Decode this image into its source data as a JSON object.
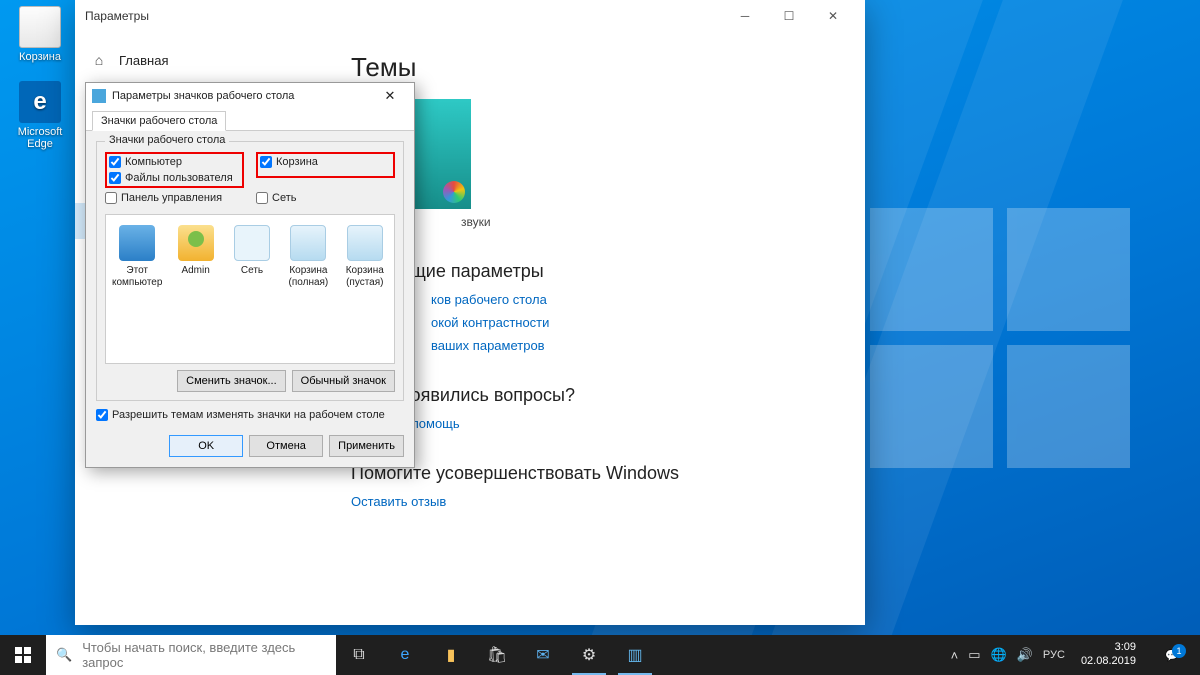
{
  "desktop": {
    "icons": [
      {
        "label": "Корзина"
      },
      {
        "label": "Microsoft Edge"
      }
    ]
  },
  "settings": {
    "title": "Параметры",
    "sidebar": {
      "home": "Главная"
    },
    "content": {
      "h1": "Темы",
      "sounds_frag": "звуки",
      "h2_related": "щие параметры",
      "link_icons": "ков рабочего стола",
      "link_contrast": "окой контрастности",
      "link_sync": "ваших параметров",
      "h2_help": "У вас появились вопросы?",
      "link_help": "Получить помощь",
      "h2_improve": "Помогите усовершенствовать Windows",
      "link_feedback": "Оставить отзыв"
    }
  },
  "dialog": {
    "title": "Параметры значков рабочего стола",
    "tab": "Значки рабочего стола",
    "group_label": "Значки рабочего стола",
    "checks": {
      "computer": "Компьютер",
      "recycle": "Корзина",
      "user_files": "Файлы пользователя",
      "control_panel": "Панель управления",
      "network": "Сеть"
    },
    "check_state": {
      "computer": true,
      "recycle": true,
      "user_files": true,
      "control_panel": false,
      "network": false,
      "allow_themes": true
    },
    "icons": [
      {
        "label": "Этот компьютер",
        "cls": "ic-pc"
      },
      {
        "label": "Admin",
        "cls": "ic-user"
      },
      {
        "label": "Сеть",
        "cls": "ic-net"
      },
      {
        "label": "Корзина (полная)",
        "cls": "ic-bin"
      },
      {
        "label": "Корзина (пустая)",
        "cls": "ic-bin"
      }
    ],
    "btn_change": "Сменить значок...",
    "btn_default": "Обычный значок",
    "allow_themes": "Разрешить темам изменять значки на рабочем столе",
    "ok": "OK",
    "cancel": "Отмена",
    "apply": "Применить"
  },
  "taskbar": {
    "search_placeholder": "Чтобы начать поиск, введите здесь запрос",
    "lang": "РУС",
    "time": "3:09",
    "date": "02.08.2019",
    "notif_count": "1"
  }
}
